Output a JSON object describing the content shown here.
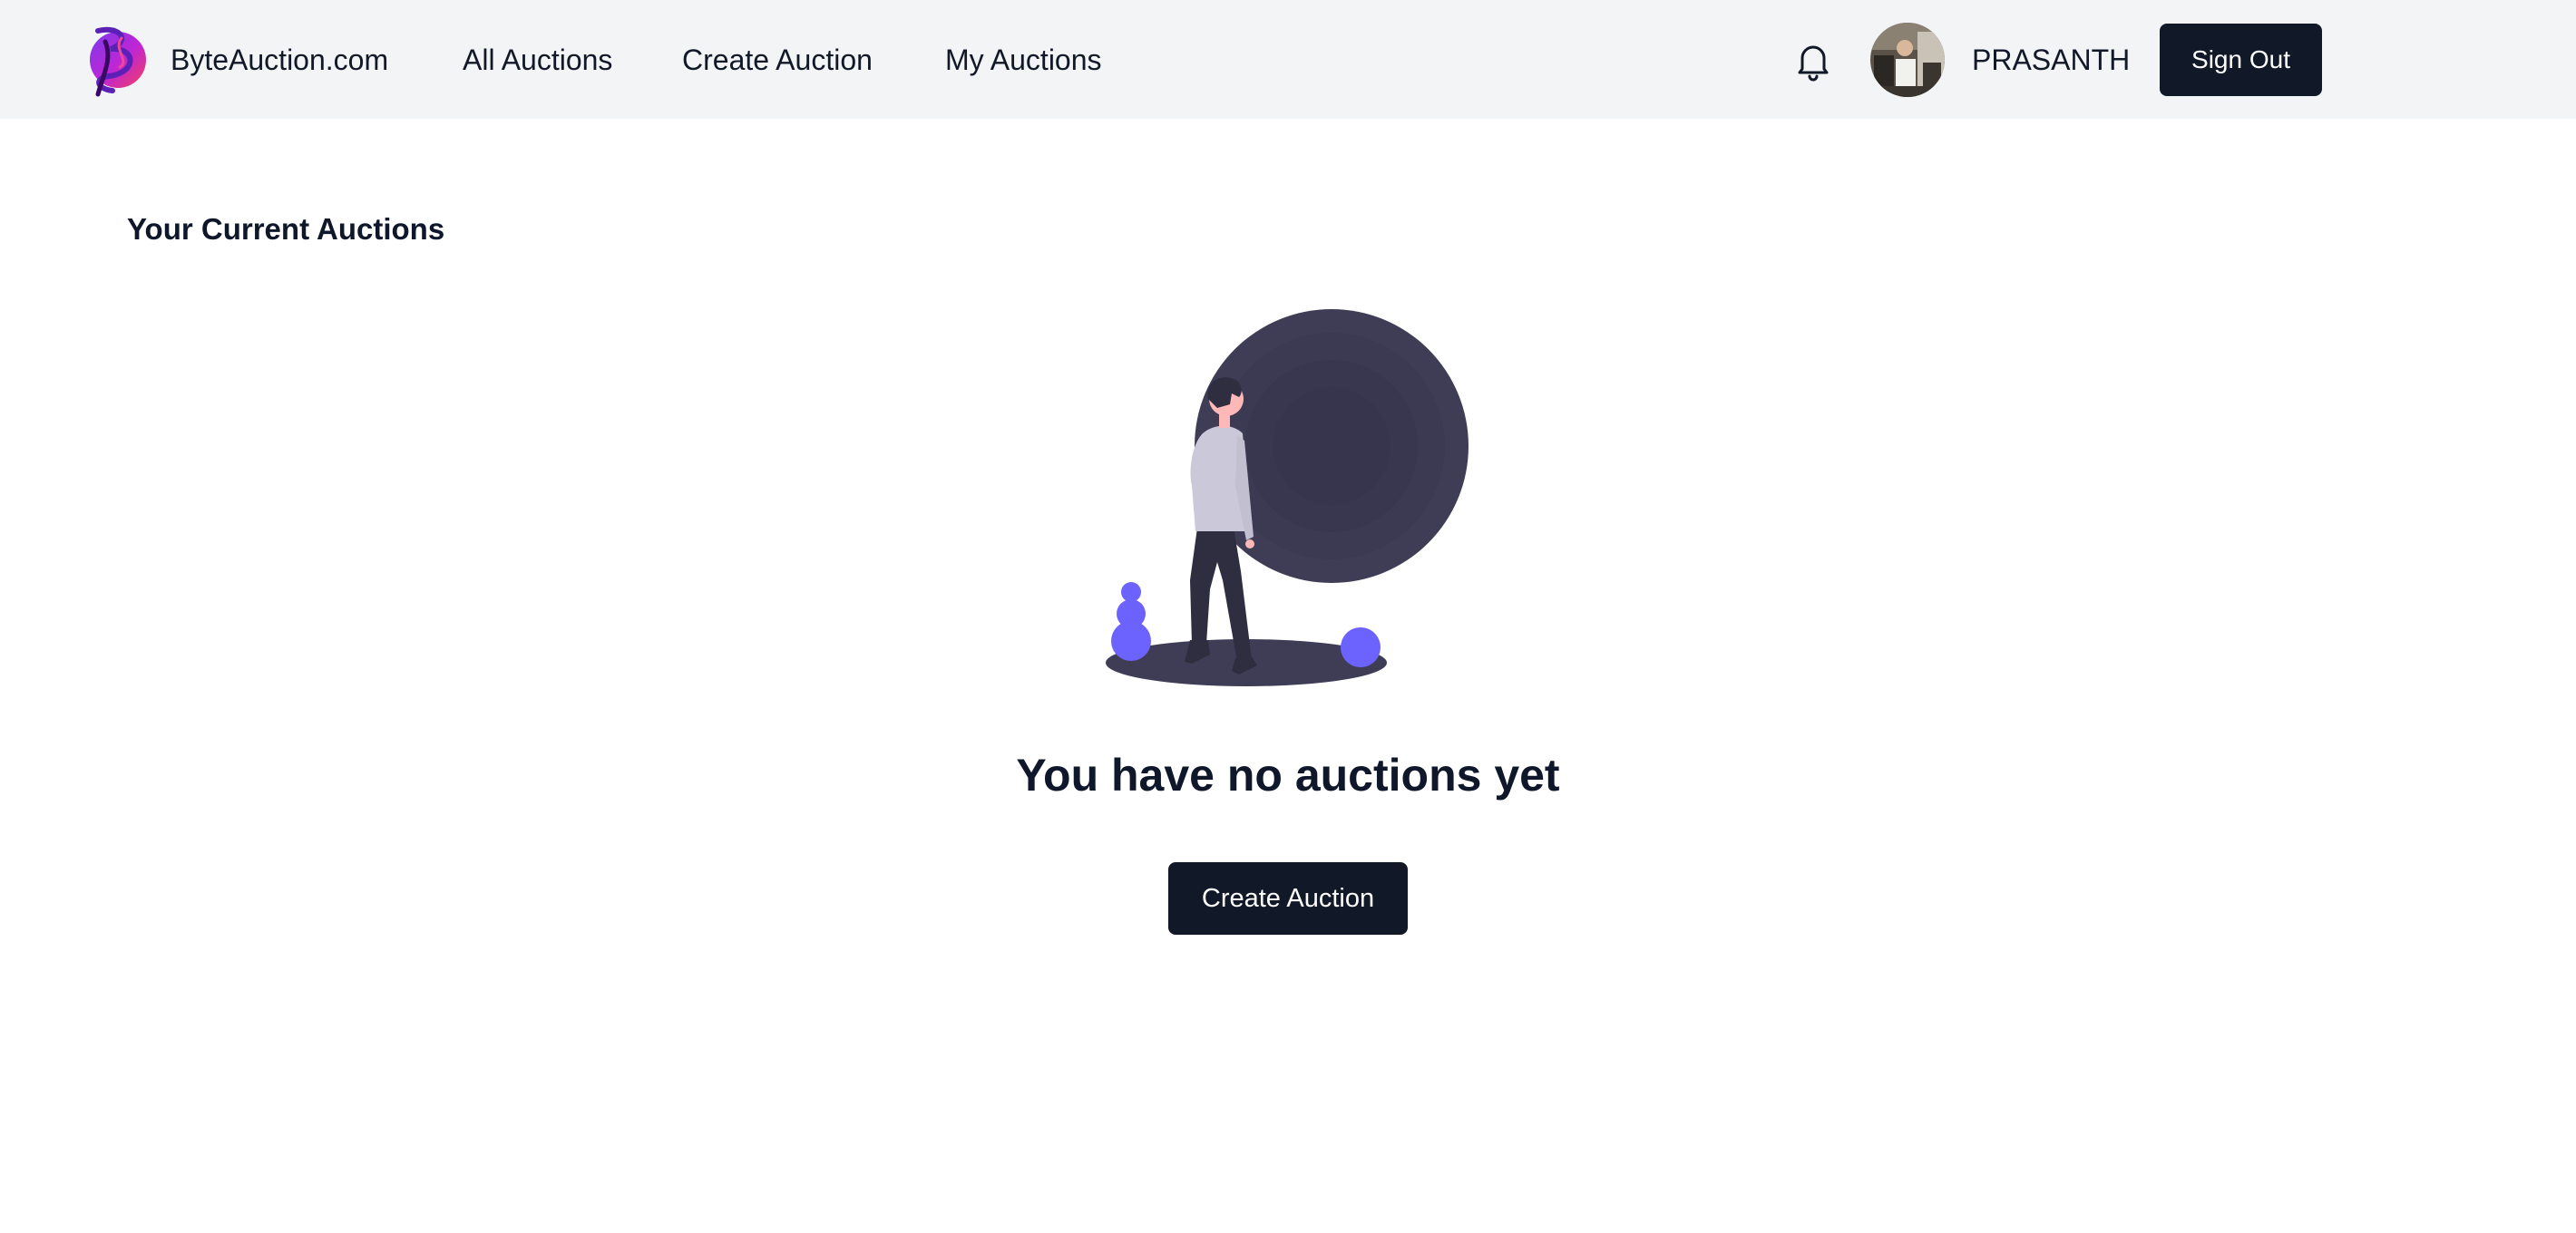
{
  "header": {
    "brand": "ByteAuction.com",
    "nav": {
      "all_auctions": "All Auctions",
      "create_auction": "Create Auction",
      "my_auctions": "My Auctions"
    },
    "username": "PRASANTH",
    "sign_out_label": "Sign Out",
    "icons": {
      "logo": "byteauction-logo-icon",
      "notifications": "bell-icon",
      "avatar": "user-avatar"
    }
  },
  "main": {
    "section_title": "Your Current Auctions",
    "empty_state": {
      "title": "You have no auctions yet",
      "button_label": "Create Auction",
      "illustration": "person-walking-empty-state-illustration"
    }
  },
  "colors": {
    "navbar_background": "#f3f4f6",
    "primary_button": "#111827",
    "illustration_dark": "#3f3d56",
    "illustration_accent": "#6c63ff"
  }
}
